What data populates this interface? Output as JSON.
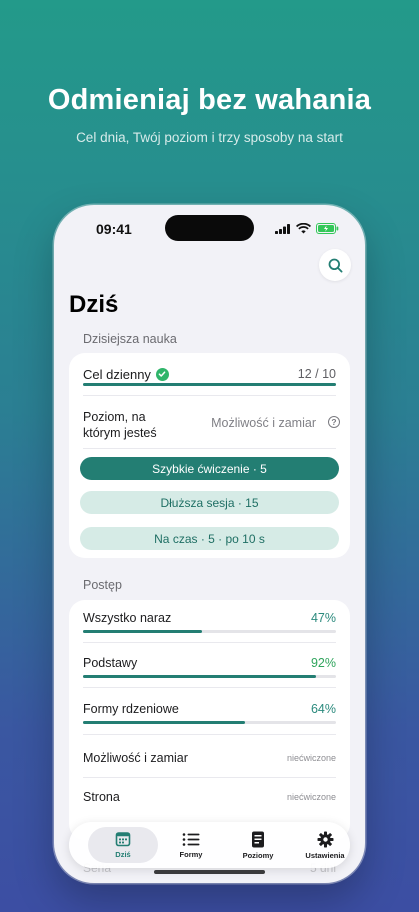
{
  "hero": {
    "title": "Odmieniaj bez wahania",
    "subtitle": "Cel dnia, Twój poziom i trzy sposoby na start"
  },
  "status_bar": {
    "time": "09:41"
  },
  "page": {
    "title": "Dziś"
  },
  "today_section": {
    "header": "Dzisiejsza nauka",
    "goal": {
      "label": "Cel dzienny",
      "count": "12 / 10",
      "progress": 1.0
    },
    "level": {
      "label": "Poziom, na którym jesteś",
      "value": "Możliwość i zamiar",
      "help": "?"
    },
    "buttons": [
      {
        "label": "Szybkie ćwiczenie · 5"
      },
      {
        "label": "Dłuższa sesja · 15"
      },
      {
        "label": "Na czas · 5 · po 10 s"
      }
    ]
  },
  "progress_section": {
    "header": "Postęp",
    "items": [
      {
        "label": "Wszystko naraz",
        "percent": "47%",
        "progress": 0.47
      },
      {
        "label": "Podstawy",
        "percent": "92%",
        "progress": 0.92
      },
      {
        "label": "Formy rdzeniowe",
        "percent": "64%",
        "progress": 0.64
      },
      {
        "label": "Możliwość i zamiar",
        "status": "niećwiczone"
      },
      {
        "label": "Strona",
        "status": "niećwiczone"
      }
    ],
    "below_tabbar": {
      "label": "Seria",
      "value": "5 dni"
    }
  },
  "tabbar": {
    "tabs": [
      {
        "label": "Dziś",
        "icon": "calendar-icon",
        "active": true
      },
      {
        "label": "Formy",
        "icon": "list-icon"
      },
      {
        "label": "Poziomy",
        "icon": "document-icon"
      },
      {
        "label": "Ustawienia",
        "icon": "gear-icon"
      }
    ]
  },
  "colors": {
    "accent": "#237e73",
    "accent_light": "#d6ebe6",
    "success": "#2fb56a"
  }
}
